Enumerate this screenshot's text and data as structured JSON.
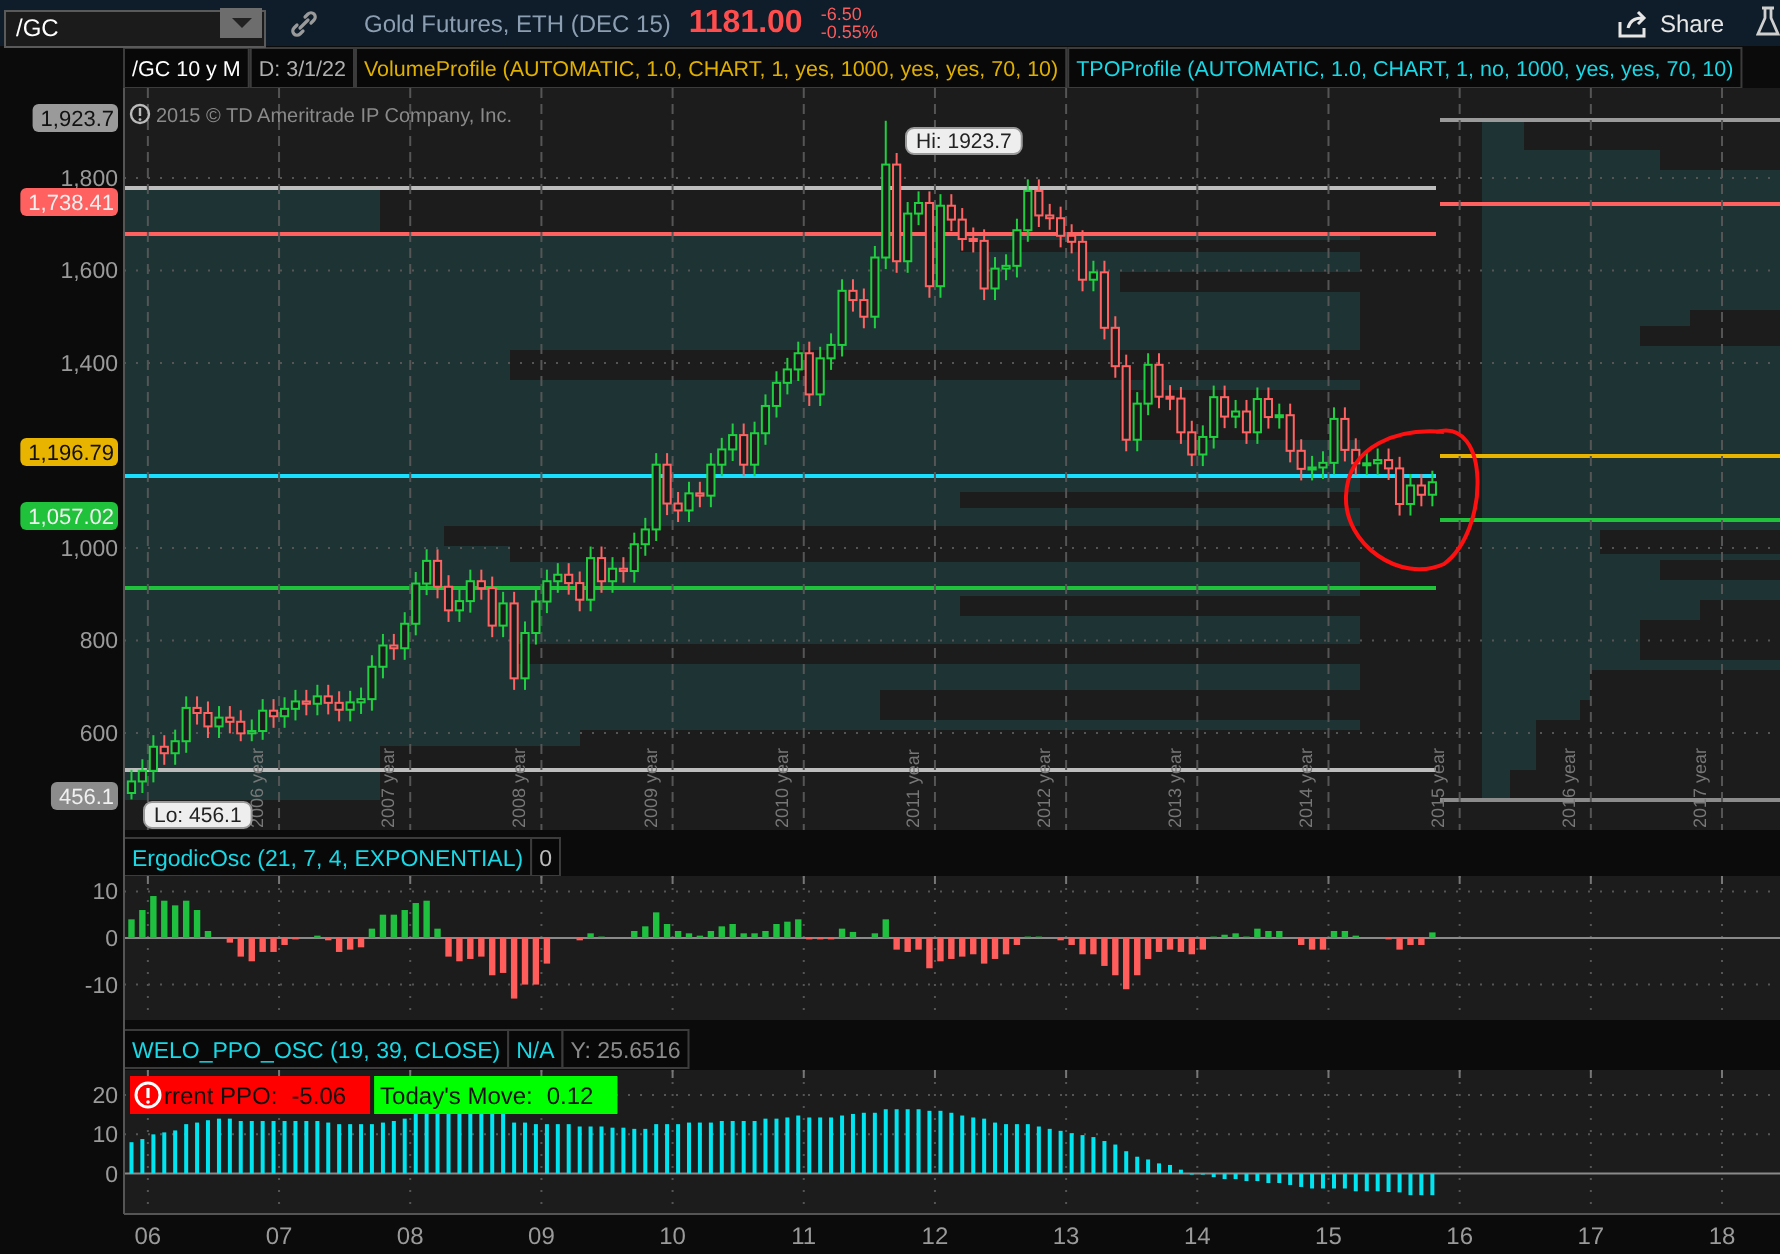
{
  "toolbar": {
    "symbol": "/GC",
    "description": "Gold Futures, ETH (DEC 15)",
    "last_price": "1181.00",
    "net_change": "-6.50",
    "percent_change": "-0.55%",
    "share_button": "Share"
  },
  "chart_header": [
    {
      "kind": "symbol",
      "text": "/GC 10 y M"
    },
    {
      "kind": "date",
      "text": "D: 3/1/22"
    },
    {
      "kind": "study",
      "text": "VolumeProfile (AUTOMATIC, 1.0, CHART, 1, yes, 1000, yes, yes, 70, 10)",
      "color": "#e0b000"
    },
    {
      "kind": "study",
      "text": "TPOProfile (AUTOMATIC, 1.0, CHART, 1, no, 1000, yes, yes, 70, 10)",
      "color": "#19d9e6"
    }
  ],
  "price_panel": {
    "copyright": "2015 © TD Ameritrade IP Company, Inc.",
    "price_labels": [
      {
        "text": "1,923.7",
        "color": "#9a9a9a"
      },
      {
        "text": "1,738.41",
        "color": "#ff6060"
      },
      {
        "text": "1,196.79",
        "color": "#e8b400"
      },
      {
        "text": "1,057.02",
        "color": "#1fc23a"
      },
      {
        "text": "456.1",
        "color": "#8c8c8c"
      }
    ],
    "high_bubble": "Hi: 1923.7",
    "low_bubble": "Lo: 456.1",
    "year_labels": [
      "2006 year",
      "2007 year",
      "2008 year",
      "2009 year",
      "2010 year",
      "2011 year",
      "2012 year",
      "2013 year",
      "2014 year",
      "2015 year",
      "2016 year",
      "2017 year"
    ],
    "chart_data": {
      "type": "candlestick",
      "grid": true,
      "xlim": [
        5.818,
        18.442
      ],
      "ylim": [
        390,
        1994.6
      ],
      "yticks": [
        {
          "value": 1800,
          "label": "1,800"
        },
        {
          "value": 1600,
          "label": "1,600"
        },
        {
          "value": 1400,
          "label": "1,400"
        },
        {
          "value": 1000,
          "label": "1,000"
        },
        {
          "value": 800,
          "label": "800"
        },
        {
          "value": 600,
          "label": "600"
        }
      ],
      "x": [
        5.875,
        5.958,
        6.042,
        6.125,
        6.208,
        6.292,
        6.375,
        6.458,
        6.542,
        6.625,
        6.708,
        6.792,
        6.875,
        6.958,
        7.042,
        7.125,
        7.208,
        7.292,
        7.375,
        7.458,
        7.542,
        7.625,
        7.708,
        7.792,
        7.875,
        7.958,
        8.042,
        8.125,
        8.208,
        8.292,
        8.375,
        8.458,
        8.542,
        8.625,
        8.708,
        8.792,
        8.875,
        8.958,
        9.042,
        9.125,
        9.208,
        9.292,
        9.375,
        9.458,
        9.542,
        9.625,
        9.708,
        9.792,
        9.875,
        9.958,
        10.042,
        10.125,
        10.208,
        10.292,
        10.375,
        10.458,
        10.542,
        10.625,
        10.708,
        10.792,
        10.875,
        10.958,
        11.042,
        11.125,
        11.208,
        11.292,
        11.375,
        11.458,
        11.542,
        11.625,
        11.708,
        11.792,
        11.875,
        11.958,
        12.042,
        12.125,
        12.208,
        12.292,
        12.375,
        12.458,
        12.542,
        12.625,
        12.708,
        12.792,
        12.875,
        12.958,
        13.042,
        13.125,
        13.208,
        13.292,
        13.375,
        13.458,
        13.542,
        13.625,
        13.708,
        13.792,
        13.875,
        13.958,
        14.042,
        14.125,
        14.208,
        14.292,
        14.375,
        14.458,
        14.542,
        14.625,
        14.708,
        14.792,
        14.875,
        14.958,
        15.042,
        15.125,
        15.208,
        15.292,
        15.375,
        15.458,
        15.542,
        15.625,
        15.708,
        15.792
      ],
      "ohlc": [
        [
          470,
          520,
          456.1,
          495
        ],
        [
          495,
          543,
          470,
          518
        ],
        [
          518,
          595,
          493,
          570
        ],
        [
          570,
          595,
          531,
          556
        ],
        [
          556,
          607,
          531,
          582
        ],
        [
          582,
          679,
          557,
          654
        ],
        [
          654,
          679,
          618,
          643
        ],
        [
          643,
          668,
          589,
          614
        ],
        [
          614,
          658,
          589,
          633
        ],
        [
          633,
          658,
          599,
          624
        ],
        [
          624,
          649,
          582,
          599
        ],
        [
          599,
          629,
          582,
          604
        ],
        [
          604,
          673,
          585,
          648
        ],
        [
          648,
          673,
          611,
          636
        ],
        [
          636,
          677,
          611,
          652
        ],
        [
          652,
          693,
          627,
          668
        ],
        [
          668,
          693,
          638,
          663
        ],
        [
          663,
          704,
          638,
          679
        ],
        [
          679,
          704,
          640,
          665
        ],
        [
          665,
          690,
          625,
          650
        ],
        [
          650,
          691,
          625,
          666
        ],
        [
          666,
          698,
          641,
          673
        ],
        [
          673,
          768,
          648,
          743
        ],
        [
          743,
          814,
          718,
          789
        ],
        [
          789,
          814,
          758,
          783
        ],
        [
          783,
          861,
          758,
          836
        ],
        [
          836,
          948,
          811,
          923
        ],
        [
          923,
          997,
          898,
          972
        ],
        [
          972,
          997,
          891,
          916
        ],
        [
          916,
          941,
          840,
          865
        ],
        [
          865,
          910,
          840,
          885
        ],
        [
          885,
          953,
          860,
          928
        ],
        [
          928,
          953,
          888,
          913
        ],
        [
          913,
          938,
          807,
          832
        ],
        [
          832,
          905,
          807,
          880
        ],
        [
          880,
          905,
          693,
          718
        ],
        [
          718,
          841,
          693,
          816
        ],
        [
          816,
          909,
          791,
          884
        ],
        [
          884,
          953,
          859,
          928
        ],
        [
          928,
          967,
          903,
          942
        ],
        [
          942,
          967,
          899,
          924
        ],
        [
          924,
          949,
          863,
          888
        ],
        [
          888,
          1003,
          863,
          978
        ],
        [
          978,
          1003,
          903,
          928
        ],
        [
          928,
          980,
          903,
          955
        ],
        [
          955,
          980,
          925,
          950
        ],
        [
          950,
          1033,
          925,
          1008
        ],
        [
          1008,
          1065,
          983,
          1040
        ],
        [
          1040,
          1205,
          1015,
          1180
        ],
        [
          1180,
          1205,
          1071,
          1096
        ],
        [
          1096,
          1121,
          1056,
          1081
        ],
        [
          1081,
          1143,
          1056,
          1118
        ],
        [
          1118,
          1143,
          1088,
          1113
        ],
        [
          1113,
          1205,
          1088,
          1180
        ],
        [
          1180,
          1238,
          1155,
          1213
        ],
        [
          1213,
          1269,
          1188,
          1244
        ],
        [
          1244,
          1269,
          1155,
          1180
        ],
        [
          1180,
          1273,
          1155,
          1248
        ],
        [
          1248,
          1332,
          1223,
          1307
        ],
        [
          1307,
          1382,
          1282,
          1357
        ],
        [
          1357,
          1411,
          1332,
          1386
        ],
        [
          1386,
          1446,
          1361,
          1421
        ],
        [
          1421,
          1446,
          1307,
          1332
        ],
        [
          1332,
          1435,
          1307,
          1410
        ],
        [
          1410,
          1464,
          1385,
          1439
        ],
        [
          1439,
          1581,
          1414,
          1556
        ],
        [
          1556,
          1581,
          1511,
          1536
        ],
        [
          1536,
          1561,
          1475,
          1500
        ],
        [
          1500,
          1653,
          1475,
          1628
        ],
        [
          1628,
          1923.7,
          1603,
          1829
        ],
        [
          1829,
          1854,
          1595,
          1620
        ],
        [
          1620,
          1748,
          1595,
          1723
        ],
        [
          1723,
          1771,
          1698,
          1746
        ],
        [
          1746,
          1771,
          1541,
          1566
        ],
        [
          1566,
          1765,
          1541,
          1740
        ],
        [
          1740,
          1765,
          1685,
          1710
        ],
        [
          1710,
          1735,
          1643,
          1668
        ],
        [
          1668,
          1693,
          1639,
          1664
        ],
        [
          1664,
          1689,
          1536,
          1561
        ],
        [
          1561,
          1629,
          1536,
          1604
        ],
        [
          1604,
          1635,
          1579,
          1610
        ],
        [
          1610,
          1712,
          1585,
          1687
        ],
        [
          1687,
          1797,
          1662,
          1772
        ],
        [
          1772,
          1797,
          1694,
          1719
        ],
        [
          1719,
          1744,
          1688,
          1713
        ],
        [
          1713,
          1738,
          1650,
          1675
        ],
        [
          1675,
          1700,
          1637,
          1662
        ],
        [
          1662,
          1687,
          1555,
          1580
        ],
        [
          1580,
          1621,
          1555,
          1596
        ],
        [
          1596,
          1621,
          1451,
          1476
        ],
        [
          1476,
          1501,
          1368,
          1393
        ],
        [
          1393,
          1418,
          1209,
          1234
        ],
        [
          1234,
          1337,
          1209,
          1312
        ],
        [
          1312,
          1421,
          1287,
          1396
        ],
        [
          1396,
          1421,
          1302,
          1327
        ],
        [
          1327,
          1352,
          1298,
          1323
        ],
        [
          1323,
          1348,
          1225,
          1250
        ],
        [
          1250,
          1275,
          1177,
          1202
        ],
        [
          1202,
          1265,
          1177,
          1240
        ],
        [
          1240,
          1351,
          1215,
          1326
        ],
        [
          1326,
          1351,
          1259,
          1284
        ],
        [
          1284,
          1320,
          1259,
          1295
        ],
        [
          1295,
          1320,
          1225,
          1250
        ],
        [
          1250,
          1347,
          1225,
          1322
        ],
        [
          1322,
          1347,
          1258,
          1283
        ],
        [
          1283,
          1312,
          1258,
          1287
        ],
        [
          1287,
          1312,
          1185,
          1210
        ],
        [
          1210,
          1235,
          1146,
          1171
        ],
        [
          1171,
          1199,
          1146,
          1174
        ],
        [
          1174,
          1209,
          1149,
          1184
        ],
        [
          1184,
          1304,
          1159,
          1279
        ],
        [
          1279,
          1304,
          1187,
          1212
        ],
        [
          1212,
          1237,
          1158,
          1183
        ],
        [
          1183,
          1208,
          1158,
          1183
        ],
        [
          1183,
          1215,
          1158,
          1190
        ],
        [
          1190,
          1215,
          1147,
          1172
        ],
        [
          1172,
          1197,
          1070,
          1095
        ],
        [
          1095,
          1160,
          1070,
          1135
        ],
        [
          1135,
          1160,
          1090,
          1115
        ],
        [
          1115,
          1167,
          1090,
          1142
        ]
      ]
    }
  },
  "ergodic_panel": {
    "title": "ErgodicOsc (21, 7, 4, EXPONENTIAL)",
    "value": "0",
    "chart_data": {
      "type": "bar",
      "grid": true,
      "xlim": [
        5.818,
        18.442
      ],
      "ylim": [
        -17.6,
        13.3
      ],
      "yticks": [
        {
          "value": 10,
          "label": "10"
        },
        {
          "value": 0,
          "label": "0"
        },
        {
          "value": -10,
          "label": "-10"
        }
      ],
      "x": [
        5.875,
        5.958,
        6.042,
        6.125,
        6.208,
        6.292,
        6.375,
        6.458,
        6.542,
        6.625,
        6.708,
        6.792,
        6.875,
        6.958,
        7.042,
        7.125,
        7.208,
        7.292,
        7.375,
        7.458,
        7.542,
        7.625,
        7.708,
        7.792,
        7.875,
        7.958,
        8.042,
        8.125,
        8.208,
        8.292,
        8.375,
        8.458,
        8.542,
        8.625,
        8.708,
        8.792,
        8.875,
        8.958,
        9.042,
        9.125,
        9.208,
        9.292,
        9.375,
        9.458,
        9.542,
        9.625,
        9.708,
        9.792,
        9.875,
        9.958,
        10.042,
        10.125,
        10.208,
        10.292,
        10.375,
        10.458,
        10.542,
        10.625,
        10.708,
        10.792,
        10.875,
        10.958,
        11.042,
        11.125,
        11.208,
        11.292,
        11.375,
        11.458,
        11.542,
        11.625,
        11.708,
        11.792,
        11.875,
        11.958,
        12.042,
        12.125,
        12.208,
        12.292,
        12.375,
        12.458,
        12.542,
        12.625,
        12.708,
        12.792,
        12.875,
        12.958,
        13.042,
        13.125,
        13.208,
        13.292,
        13.375,
        13.458,
        13.542,
        13.625,
        13.708,
        13.792,
        13.875,
        13.958,
        14.042,
        14.125,
        14.208,
        14.292,
        14.375,
        14.458,
        14.542,
        14.625,
        14.708,
        14.792,
        14.875,
        14.958,
        15.042,
        15.125,
        15.208,
        15.292,
        15.375,
        15.458,
        15.542,
        15.625,
        15.708,
        15.792
      ],
      "series": [
        {
          "color": "#1fbf3f",
          "values": [
            4,
            6,
            9,
            8,
            7,
            8,
            6,
            1.5,
            null,
            null,
            null,
            null,
            null,
            null,
            null,
            null,
            null,
            0.5,
            null,
            null,
            null,
            null,
            2,
            5,
            5,
            6,
            7.5,
            8,
            2,
            null,
            null,
            null,
            null,
            null,
            null,
            null,
            null,
            null,
            null,
            null,
            null,
            null,
            1,
            0.3,
            null,
            null,
            1.5,
            2.5,
            5.5,
            3,
            1.5,
            1,
            0.5,
            1.5,
            2.5,
            3,
            1,
            1,
            1.5,
            3,
            3.5,
            4,
            null,
            null,
            null,
            2,
            1.3,
            null,
            1,
            4,
            null,
            null,
            null,
            null,
            null,
            null,
            null,
            null,
            null,
            null,
            null,
            null,
            0.3,
            0.3,
            null,
            null,
            null,
            null,
            null,
            null,
            null,
            null,
            null,
            null,
            null,
            null,
            null,
            null,
            null,
            0.3,
            0.7,
            1,
            0.3,
            2,
            1.5,
            1.5,
            null,
            null,
            null,
            null,
            1.5,
            1.5,
            0.5,
            null,
            null,
            null,
            null,
            null,
            null,
            1.2
          ]
        },
        {
          "color": "#ff5c5c",
          "values": [
            null,
            null,
            null,
            null,
            null,
            null,
            null,
            null,
            null,
            -1,
            -4,
            -5,
            -3,
            -3,
            -1.5,
            -0.3,
            null,
            null,
            -0.5,
            -3,
            -2.5,
            -2,
            null,
            null,
            null,
            null,
            null,
            null,
            null,
            -4,
            -5,
            -4.5,
            -4,
            -8,
            -7.5,
            -13,
            -10,
            -10,
            -5.5,
            null,
            null,
            -0.5,
            null,
            null,
            null,
            null,
            null,
            null,
            null,
            null,
            null,
            null,
            null,
            null,
            null,
            null,
            null,
            null,
            null,
            null,
            null,
            null,
            -0.3,
            -0.3,
            -0.3,
            null,
            null,
            null,
            null,
            null,
            -2.5,
            -3,
            -2.5,
            -6.5,
            -5,
            -4.5,
            -4,
            -3.5,
            -5.5,
            -4.5,
            -3.5,
            -1.5,
            null,
            null,
            null,
            -0.5,
            -1.5,
            -3.5,
            -3.5,
            -6,
            -8,
            -11,
            -8,
            -4.5,
            -3,
            -2.5,
            -3,
            -3.5,
            -2.5,
            null,
            null,
            null,
            null,
            null,
            null,
            null,
            null,
            -1.5,
            -2.5,
            -2.5,
            null,
            null,
            null,
            null,
            null,
            -0.3,
            -2.5,
            -1.5,
            -1.5,
            null
          ]
        }
      ]
    }
  },
  "ppo_panel": {
    "title": "WELO_PPO_OSC (19, 39, CLOSE)",
    "value": "N/A",
    "cursor_value": "Y: 25.6516",
    "labels": [
      {
        "text": "rrent PPO:",
        "value": "-5.06",
        "color": "#ff0000",
        "alert": true
      },
      {
        "text": "Today's Move:",
        "value": "0.12",
        "color": "#00ff00",
        "alert": false
      }
    ],
    "chart_data": {
      "type": "bar",
      "grid": true,
      "xlim": [
        5.818,
        18.442
      ],
      "ylim": [
        -10.3,
        26.4
      ],
      "yticks": [
        20,
        10,
        0
      ],
      "xticks": [
        {
          "value": 6,
          "label": "06"
        },
        {
          "value": 7,
          "label": "07"
        },
        {
          "value": 8,
          "label": "08"
        },
        {
          "value": 9,
          "label": "09"
        },
        {
          "value": 10,
          "label": "10"
        },
        {
          "value": 11,
          "label": "11"
        },
        {
          "value": 12,
          "label": "12"
        },
        {
          "value": 13,
          "label": "13"
        },
        {
          "value": 14,
          "label": "14"
        },
        {
          "value": 15,
          "label": "15"
        },
        {
          "value": 16,
          "label": "16"
        },
        {
          "value": 17,
          "label": "17"
        },
        {
          "value": 18,
          "label": "18"
        }
      ],
      "x": [
        5.875,
        5.958,
        6.042,
        6.125,
        6.208,
        6.292,
        6.375,
        6.458,
        6.542,
        6.625,
        6.708,
        6.792,
        6.875,
        6.958,
        7.042,
        7.125,
        7.208,
        7.292,
        7.375,
        7.458,
        7.542,
        7.625,
        7.708,
        7.792,
        7.875,
        7.958,
        8.042,
        8.125,
        8.208,
        8.292,
        8.375,
        8.458,
        8.542,
        8.625,
        8.708,
        8.792,
        8.875,
        8.958,
        9.042,
        9.125,
        9.208,
        9.292,
        9.375,
        9.458,
        9.542,
        9.625,
        9.708,
        9.792,
        9.875,
        9.958,
        10.042,
        10.125,
        10.208,
        10.292,
        10.375,
        10.458,
        10.542,
        10.625,
        10.708,
        10.792,
        10.875,
        10.958,
        11.042,
        11.125,
        11.208,
        11.292,
        11.375,
        11.458,
        11.542,
        11.625,
        11.708,
        11.792,
        11.875,
        11.958,
        12.042,
        12.125,
        12.208,
        12.292,
        12.375,
        12.458,
        12.542,
        12.625,
        12.708,
        12.792,
        12.875,
        12.958,
        13.042,
        13.125,
        13.208,
        13.292,
        13.375,
        13.458,
        13.542,
        13.625,
        13.708,
        13.792,
        13.875,
        13.958,
        14.042,
        14.125,
        14.208,
        14.292,
        14.375,
        14.458,
        14.542,
        14.625,
        14.708,
        14.792,
        14.875,
        14.958,
        15.042,
        15.125,
        15.208,
        15.292,
        15.375,
        15.458,
        15.542,
        15.625,
        15.708,
        15.792
      ],
      "series": [
        {
          "color": "#00e5ef",
          "values": [
            8,
            8.8,
            10,
            10.5,
            11,
            12.6,
            13,
            13.6,
            14,
            14,
            13.4,
            13.4,
            13.4,
            13.4,
            13.4,
            13.4,
            13.4,
            13.4,
            13,
            12.6,
            12.6,
            12.6,
            12.6,
            13,
            13.4,
            14,
            15.2,
            15.2,
            15.2,
            15.2,
            15.2,
            15.2,
            15.2,
            15.2,
            15.2,
            13,
            13,
            12.6,
            12.6,
            12.6,
            12.6,
            12,
            12,
            12,
            11.7,
            11.7,
            11.4,
            11.4,
            12.6,
            12.6,
            12.6,
            13,
            13,
            13,
            13.4,
            13.4,
            13.4,
            13.4,
            14,
            14,
            14.3,
            14.8,
            14.3,
            14.3,
            14.3,
            14.8,
            15.2,
            15.5,
            15.5,
            16.4,
            16.4,
            16.4,
            16.4,
            16,
            16,
            15.5,
            14.8,
            14.3,
            14,
            13,
            12.6,
            12.6,
            12.6,
            12,
            11.4,
            10.9,
            10.3,
            9.8,
            9.3,
            8.3,
            7.4,
            5.7,
            4.3,
            3.6,
            2.6,
            2.2,
            1,
            0,
            -0.2,
            -0.9,
            -1.4,
            -1.4,
            -1.9,
            -1.9,
            -2.4,
            -2.4,
            -2.9,
            -3.4,
            -3.8,
            -3.8,
            -3.8,
            -3.8,
            -4.5,
            -4.5,
            -4.5,
            -4.7,
            -4.8,
            -5.5,
            -5.5,
            -5.5
          ]
        }
      ]
    }
  }
}
